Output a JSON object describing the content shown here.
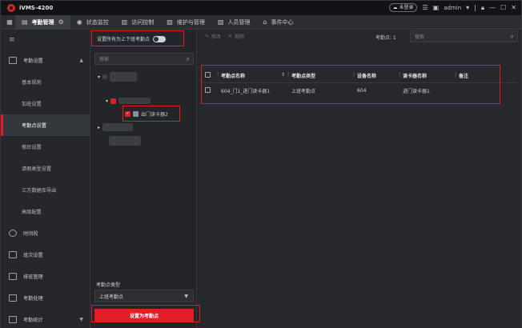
{
  "app": {
    "title": "iVMS-4200",
    "unregistered": "未登录",
    "user": "admin",
    "colors": {
      "accent": "#e21d25",
      "bg": "#1f2124"
    }
  },
  "tabs": [
    {
      "label": "考勤管理",
      "icon": "calendar-icon"
    },
    {
      "label": "状态监控",
      "icon": "monitor-icon"
    },
    {
      "label": "访问控制",
      "icon": "door-icon"
    },
    {
      "label": "维护与管理",
      "icon": "maintenance-icon"
    },
    {
      "label": "人员管理",
      "icon": "person-icon"
    },
    {
      "label": "事件中心",
      "icon": "event-icon"
    }
  ],
  "nav": {
    "section_attendance": "考勤设置",
    "items": [
      "基本规则",
      "加班设置",
      "考勤点设置",
      "假日设置",
      "请假类型设置",
      "三方数据库导出",
      "高级配置"
    ],
    "section_timeslot": "时间段",
    "section_shift": "班次设置",
    "section_schedule": "排班管理",
    "section_process": "考勤处理",
    "section_stats": "考勤统计"
  },
  "tree": {
    "toggle_label": "设置所有为上下班考勤点",
    "search_placeholder": "搜索",
    "reader_label": "出门读卡器2",
    "type_label": "考勤点类型",
    "type_value": "上班考勤点",
    "set_button": "设置为考勤点"
  },
  "main": {
    "edit_label": "修改",
    "delete_label": "删除",
    "count_label": "考勤点: 1",
    "search_placeholder": "搜索",
    "columns": [
      "考勤点名称",
      "考勤点类型",
      "设备名称",
      "读卡器名称",
      "备注"
    ],
    "rows": [
      {
        "name": "604_门1_进门读卡器1",
        "type": "上班考勤点",
        "device": "604",
        "reader": "进门读卡器1",
        "note": ""
      }
    ]
  }
}
